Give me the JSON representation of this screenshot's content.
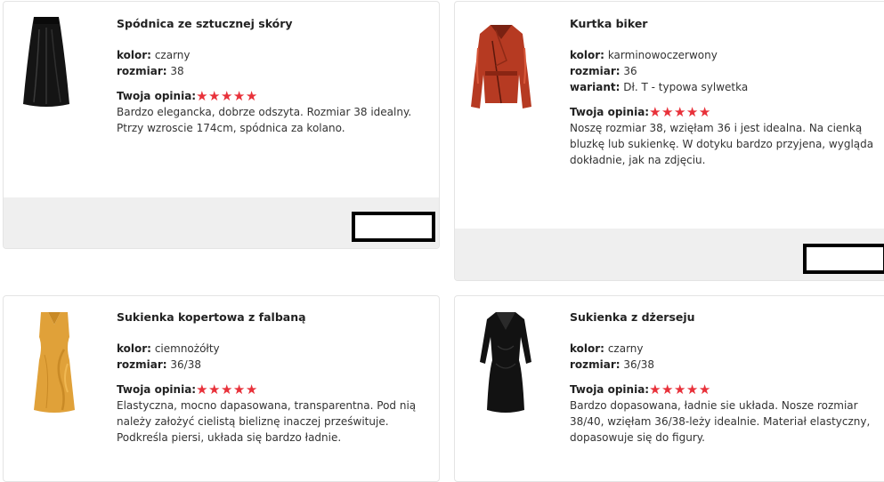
{
  "labels": {
    "color": "kolor:",
    "size": "rozmiar:",
    "variant": "wariant:",
    "rating": "Twoja opinia:"
  },
  "colors": {
    "star": "#e8313a",
    "footer": "#efefef"
  },
  "reviews": [
    {
      "title": "Spódnica ze sztucznej skóry",
      "color": "czarny",
      "size": "38",
      "rating": 5,
      "stars": "★★★★★",
      "text": "Bardzo elegancka, dobrze odszyta. Rozmiar 38 idealny. Ptrzy wzroscie 174cm, spódnica za kolano.",
      "image_icon": "black-leather-skirt-icon"
    },
    {
      "title": "Kurtka biker",
      "color": "karminowoczerwony",
      "size": "36",
      "variant": "Dł. T - typowa sylwetka",
      "rating": 5,
      "stars": "★★★★★",
      "text": "Noszę rozmiar 38, wzięłam 36 i jest idealna. Na cienką bluzkę lub sukienkę. W dotyku bardzo przyjena, wygląda dokładnie, jak na zdjęciu.",
      "image_icon": "red-biker-jacket-icon"
    },
    {
      "title": "Sukienka kopertowa z falbaną",
      "color": "ciemnożółty",
      "size": "36/38",
      "rating": 5,
      "stars": "★★★★★",
      "text": "Elastyczna, mocno dapasowana, transparentna. Pod nią należy założyć cielistą bieliznę inaczej prześwituje. Podkreśla piersi, układa się bardzo ładnie.",
      "image_icon": "yellow-wrap-dress-icon"
    },
    {
      "title": "Sukienka z dżerseju",
      "color": "czarny",
      "size": "36/38",
      "rating": 5,
      "stars": "★★★★★",
      "text": "Bardzo dopasowana, ładnie sie układa. Nosze rozmiar 38/40, wzięłam 36/38-leży idealnie. Materiał elastyczny, dopasowuje się do figury.",
      "image_icon": "black-jersey-dress-icon"
    }
  ]
}
